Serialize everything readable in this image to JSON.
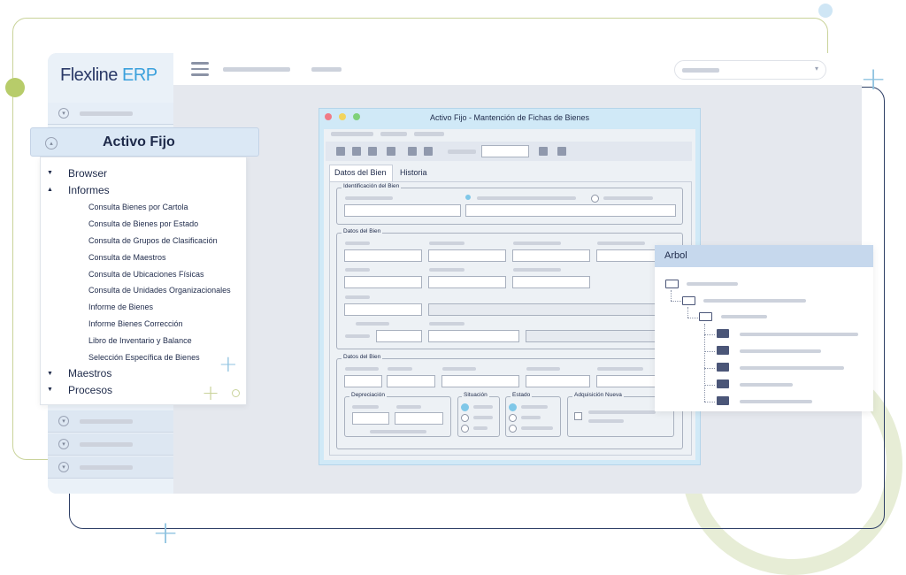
{
  "app": {
    "logo_main": "Flexline",
    "logo_accent": "ERP"
  },
  "menu": {
    "title": "Activo Fijo",
    "items": [
      {
        "label": "Browser",
        "expanded": false
      },
      {
        "label": "Informes",
        "expanded": true
      },
      {
        "label": "Maestros",
        "expanded": false
      },
      {
        "label": "Procesos",
        "expanded": false
      }
    ],
    "informes": [
      "Consulta Bienes por Cartola",
      "Consulta de Bienes por Estado",
      "Consulta de Grupos de Clasificación",
      "Consulta de Maestros",
      "Consulta de Ubicaciones Físicas",
      "Consulta de Unidades Organizacionales",
      "Informe de Bienes",
      "Informe Bienes Corrección",
      "Libro de Inventario y Balance",
      "Selección Específica de Bienes"
    ]
  },
  "window": {
    "title": "Activo Fijo - Mantención de Fichas de Bienes",
    "tabs": [
      "Datos del Bien",
      "Historia"
    ],
    "sections": {
      "identificacion": "Identificación del Bien",
      "datos1": "Datos del Bien",
      "datos2": "Datos del Bien",
      "depreciacion": "Depreciación",
      "situacion": "Situación",
      "estado": "Estado",
      "adquisicion": "Adquisición Nueva"
    }
  },
  "arbol": {
    "title": "Arbol"
  },
  "colors": {
    "brand": "#2b3a68",
    "accent": "#3aa0dc",
    "window_frame": "#d0e9f7",
    "tree_header": "#c6d8ed"
  }
}
